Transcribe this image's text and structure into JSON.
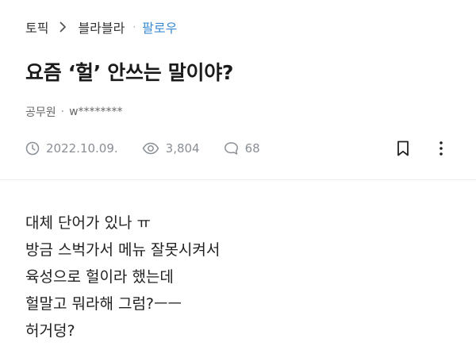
{
  "breadcrumb": {
    "topic": "토픽",
    "channel": "블라블라",
    "dot": "·",
    "follow": "팔로우"
  },
  "post": {
    "title": "요즘 ‘헐’ 안쓰는 말이야?",
    "author_company": "공무원",
    "author_dot": "·",
    "author_name": "w********",
    "date": "2022.10.09.",
    "views": "3,804",
    "comments": "68",
    "body_lines": [
      "대체 단어가 있나 ㅠ",
      "방금 스벅가서 메뉴 잘못시켜서",
      "육성으로 헐이라 했는데",
      "헐말고 뭐라해 그럼?ㅡㅡ",
      "허거덩?"
    ]
  },
  "icons": {
    "chevron": "chevron-right-icon",
    "clock": "clock-icon",
    "eye": "eye-icon",
    "comment": "comment-bubble-icon",
    "bookmark": "bookmark-icon",
    "more": "more-vertical-icon"
  },
  "colors": {
    "follow": "#3a8bd4",
    "meta": "#8a8f95",
    "title": "#1a1a1a"
  }
}
